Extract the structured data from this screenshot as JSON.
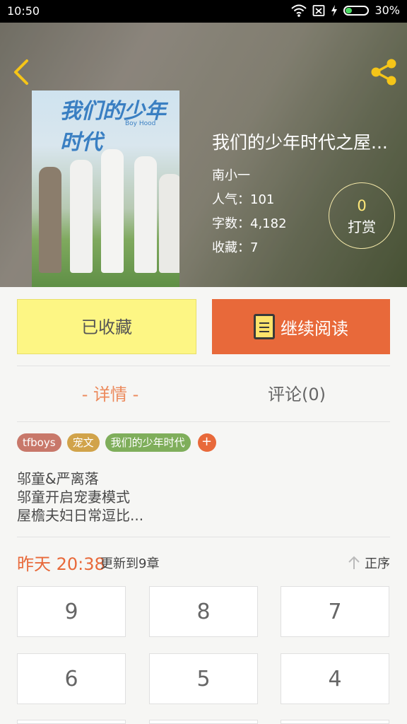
{
  "status_bar": {
    "time": "10:50",
    "battery": "30%",
    "battery_level": 0.3
  },
  "book": {
    "title": "我们的少年时代之屋...",
    "author": "南小一",
    "popularity": "人气：101",
    "word_count": "字数：4,182",
    "favorites": "收藏：7",
    "cover_title": "我们的少年时代",
    "cover_subtitle": "Boy Hood"
  },
  "reward": {
    "count": "0",
    "label": "打赏"
  },
  "actions": {
    "collected_label": "已收藏",
    "continue_label": "继续阅读"
  },
  "tabs": {
    "detail": "- 详情 -",
    "comments": "评论(0)"
  },
  "tags": [
    {
      "label": "tfboys",
      "color": "#c8786a"
    },
    {
      "label": "宠文",
      "color": "#d1a34a"
    },
    {
      "label": "我们的少年时代",
      "color": "#7fae5b"
    }
  ],
  "description": [
    "邬童&严离落",
    "邬童开启宠妻模式",
    "屋檐夫妇日常逗比..."
  ],
  "update": {
    "time": "昨天 20:38",
    "chapter": "更新到9章",
    "sort_label": "正序"
  },
  "chapters": [
    "9",
    "8",
    "7",
    "6",
    "5",
    "4",
    "",
    "",
    ""
  ],
  "colors": {
    "accent": "#e8693a",
    "collected_bg": "#fdf684",
    "tab_active": "#ec8a5c"
  }
}
